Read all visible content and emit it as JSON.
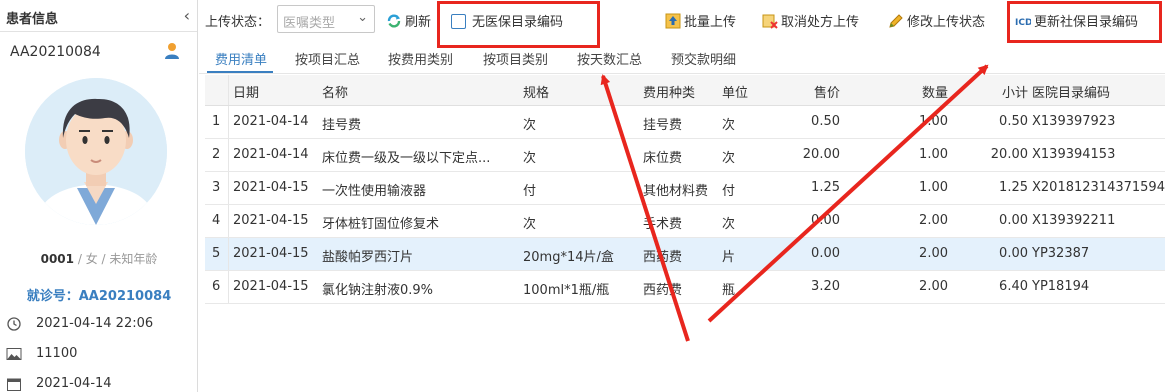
{
  "patient": {
    "panel_title": "患者信息",
    "patient_id": "AA20210084",
    "code": "0001",
    "info_rest": " / 女 / 未知年龄",
    "visit_label": "就诊号：AA20210084",
    "visit_time": "2021-04-14 22:06",
    "dept": "11100",
    "date": "2021-04-14"
  },
  "toolbar": {
    "status_label": "上传状态：",
    "status_placeholder": "医嘱类型",
    "refresh": "刷新",
    "no_catalog": "无医保目录编码",
    "batch_upload": "批量上传",
    "cancel_upload": "取消处方上传",
    "edit_status": "修改上传状态",
    "update_code": "更新社保目录编码"
  },
  "tabs": [
    "费用清单",
    "按项目汇总",
    "按费用类别",
    "按项目类别",
    "按天数汇总",
    "预交款明细"
  ],
  "table": {
    "headers": {
      "date": "日期",
      "name": "名称",
      "spec": "规格",
      "fee_type": "费用种类",
      "unit": "单位",
      "price": "售价",
      "qty": "数量",
      "subtotal": "小计",
      "code": "医院目录编码"
    },
    "rows": [
      {
        "n": "1",
        "date": "2021-04-14",
        "name": "挂号费",
        "spec": "次",
        "fee_type": "挂号费",
        "unit": "次",
        "price": "0.50",
        "qty": "1.00",
        "subtotal": "0.50",
        "code": "X139397923"
      },
      {
        "n": "2",
        "date": "2021-04-14",
        "name": "床位费一级及一级以下定点...",
        "spec": "次",
        "fee_type": "床位费",
        "unit": "次",
        "price": "20.00",
        "qty": "1.00",
        "subtotal": "20.00",
        "code": "X139394153"
      },
      {
        "n": "3",
        "date": "2021-04-15",
        "name": "一次性使用输液器",
        "spec": "付",
        "fee_type": "其他材料费",
        "unit": "付",
        "price": "1.25",
        "qty": "1.00",
        "subtotal": "1.25",
        "code": "X201812314371594"
      },
      {
        "n": "4",
        "date": "2021-04-15",
        "name": "牙体桩钉固位修复术",
        "spec": "次",
        "fee_type": "手术费",
        "unit": "次",
        "price": "0.00",
        "qty": "2.00",
        "subtotal": "0.00",
        "code": "X139392211"
      },
      {
        "n": "5",
        "date": "2021-04-15",
        "name": "盐酸帕罗西汀片",
        "spec": "20mg*14片/盒",
        "fee_type": "西药费",
        "unit": "片",
        "price": "0.00",
        "qty": "2.00",
        "subtotal": "0.00",
        "code": "YP32387"
      },
      {
        "n": "6",
        "date": "2021-04-15",
        "name": "氯化钠注射液0.9%",
        "spec": "100ml*1瓶/瓶",
        "fee_type": "西药费",
        "unit": "瓶",
        "price": "3.20",
        "qty": "2.00",
        "subtotal": "6.40",
        "code": "YP18194"
      }
    ]
  },
  "colors": {
    "accent": "#3a7fc0",
    "annotation": "#e8261e",
    "selected_row": "#e4f1fc"
  },
  "icons": [
    "chevron-left-icon",
    "user-icon",
    "clock-icon",
    "image-icon",
    "calendar-icon",
    "refresh-icon",
    "checkbox-icon",
    "upload-icon",
    "cancel-icon",
    "edit-icon",
    "icd-icon"
  ]
}
